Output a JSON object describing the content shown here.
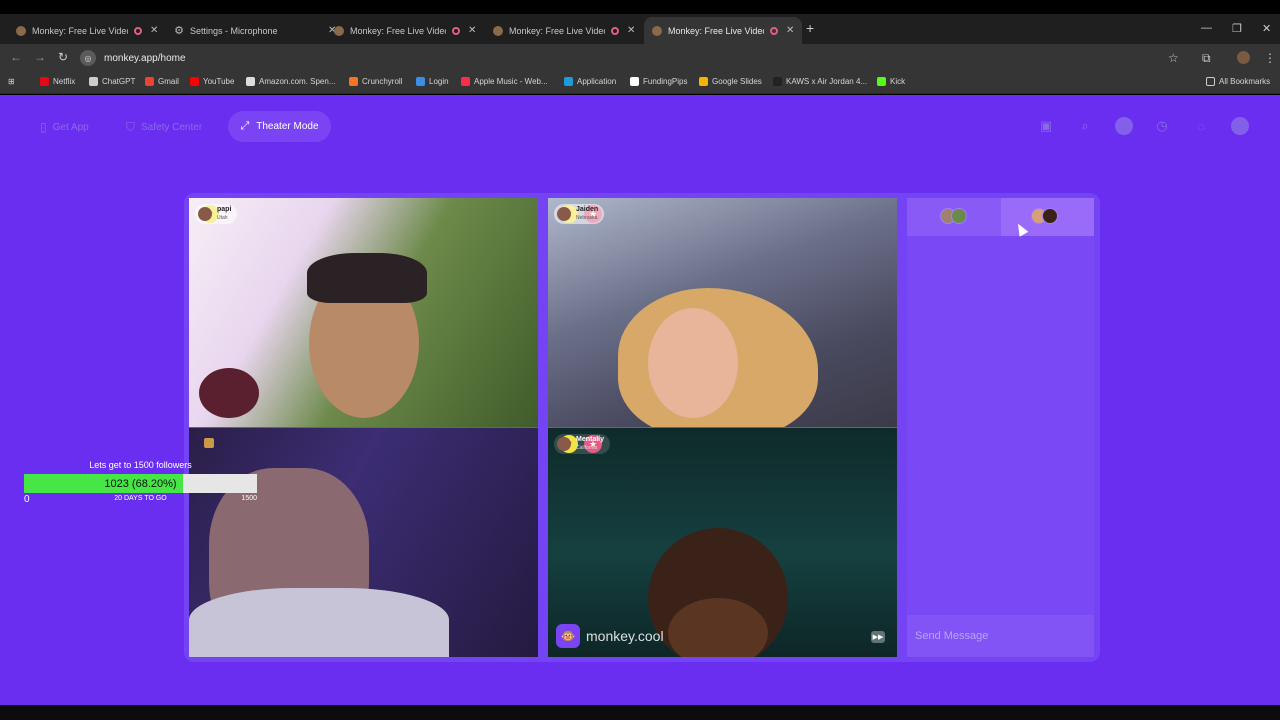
{
  "browser": {
    "tabs": [
      {
        "title": "Monkey: Free Live Video Ch",
        "icon": "monkey-icon",
        "active": false
      },
      {
        "title": "Settings - Microphone",
        "icon": "gear-icon",
        "active": false
      },
      {
        "title": "Monkey: Free Live Video Ch",
        "icon": "monkey-icon",
        "active": false
      },
      {
        "title": "Monkey: Free Live Video Ch",
        "icon": "monkey-icon",
        "active": false
      },
      {
        "title": "Monkey: Free Live Video Ch",
        "icon": "monkey-icon",
        "active": true
      }
    ],
    "url": "monkey.app/home",
    "bookmarks": [
      {
        "label": "Netflix",
        "color": "#e50914"
      },
      {
        "label": "ChatGPT",
        "color": "#cccccc"
      },
      {
        "label": "Gmail",
        "color": "#ea4335"
      },
      {
        "label": "YouTube",
        "color": "#ff0000"
      },
      {
        "label": "Amazon.com. Spen...",
        "color": "#dddddd"
      },
      {
        "label": "Crunchyroll",
        "color": "#f47521"
      },
      {
        "label": "Login",
        "color": "#3a8ee6"
      },
      {
        "label": "Apple Music - Web...",
        "color": "#fa2d48"
      },
      {
        "label": "Application",
        "color": "#1f9bd8"
      },
      {
        "label": "FundingPips",
        "color": "#ffffff"
      },
      {
        "label": "Google Slides",
        "color": "#f4b400"
      },
      {
        "label": "KAWS x Air Jordan 4...",
        "color": "#222222"
      },
      {
        "label": "Kick",
        "color": "#53fc18"
      }
    ],
    "all_bookmarks": "All Bookmarks"
  },
  "header": {
    "get_app": "Get App",
    "safety_center": "Safety Center",
    "theater_mode": "Theater Mode"
  },
  "videos": [
    {
      "name": "papi",
      "location": "Utah"
    },
    {
      "name": "Jaiden",
      "location": "Nebraska"
    },
    {
      "name": "",
      "location": ""
    },
    {
      "name": "Mentally",
      "location": "California"
    }
  ],
  "watermark": "monkey.cool",
  "chat": {
    "placeholder": "Send Message"
  },
  "goal": {
    "title": "Lets get to 1500 followers",
    "value_label": "1023 (68.20%)",
    "progress": 0.682,
    "min": "0",
    "max": "1500",
    "days_left": "20 DAYS TO GO"
  },
  "colors": {
    "page_bg": "#6a2ef0",
    "accent": "#7a44f5",
    "goal_fill": "#46e646"
  }
}
